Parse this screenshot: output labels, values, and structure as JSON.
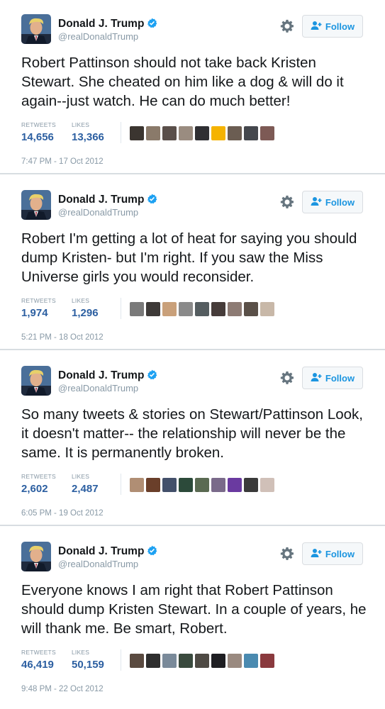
{
  "colors": {
    "accent": "#1b95e0",
    "count_blue": "#2c5fa1",
    "muted": "#8899a6",
    "verified": "#1da1f2"
  },
  "icons": [
    "verified-badge-icon",
    "gear-icon",
    "follow-person-icon"
  ],
  "tweets": [
    {
      "name": "Donald J. Trump",
      "handle": "@realDonaldTrump",
      "follow_label": "Follow",
      "text": "Robert Pattinson should not take back Kristen Stewart. She cheated on him like a dog & will do it again--just watch. He can do much better!",
      "retweets_label": "RETWEETS",
      "retweets": "14,656",
      "likes_label": "LIKES",
      "likes": "13,366",
      "timestamp": "7:47 PM - 17 Oct 2012",
      "liker_avatars": [
        "#3b3530",
        "#8a7a6a",
        "#5a4f4a",
        "#9a8c80",
        "#2f2f33",
        "#f5b301",
        "#6b5d52",
        "#44474d",
        "#7d5a55"
      ]
    },
    {
      "name": "Donald J. Trump",
      "handle": "@realDonaldTrump",
      "follow_label": "Follow",
      "text": "Robert I'm getting a lot of heat for saying you should dump Kristen- but I'm right. If you saw the Miss Universe girls you would reconsider.",
      "retweets_label": "RETWEETS",
      "retweets": "1,974",
      "likes_label": "LIKES",
      "likes": "1,296",
      "timestamp": "5:21 PM - 18 Oct 2012",
      "liker_avatars": [
        "#7a7a7a",
        "#3e3a38",
        "#c9a07a",
        "#8a8a8a",
        "#555d60",
        "#463c3a",
        "#8d7b74",
        "#5a5048",
        "#c8b8a8"
      ]
    },
    {
      "name": "Donald J. Trump",
      "handle": "@realDonaldTrump",
      "follow_label": "Follow",
      "text": "So many tweets & stories on Stewart/Pattinson Look, it doesn't matter-- the relationship will never be the same. It is permanently broken.",
      "retweets_label": "RETWEETS",
      "retweets": "2,602",
      "likes_label": "LIKES",
      "likes": "2,487",
      "timestamp": "6:05 PM - 19 Oct 2012",
      "liker_avatars": [
        "#b08e74",
        "#6a3f2a",
        "#43506a",
        "#2c4a3a",
        "#5a6a52",
        "#7a6a8a",
        "#6a3aa0",
        "#3a3a3a",
        "#d0c0b8"
      ]
    },
    {
      "name": "Donald J. Trump",
      "handle": "@realDonaldTrump",
      "follow_label": "Follow",
      "text": "Everyone knows I am right that Robert Pattinson should dump Kristen Stewart. In a couple of years, he will thank me. Be smart, Robert.",
      "retweets_label": "RETWEETS",
      "retweets": "46,419",
      "likes_label": "LIKES",
      "likes": "50,159",
      "timestamp": "9:48 PM - 22 Oct 2012",
      "liker_avatars": [
        "#5a4a40",
        "#2e2e2e",
        "#7a8a9a",
        "#3a4a3e",
        "#4e4a44",
        "#1e1e22",
        "#9a8a80",
        "#4a8ab0",
        "#8a3a3e"
      ]
    }
  ]
}
